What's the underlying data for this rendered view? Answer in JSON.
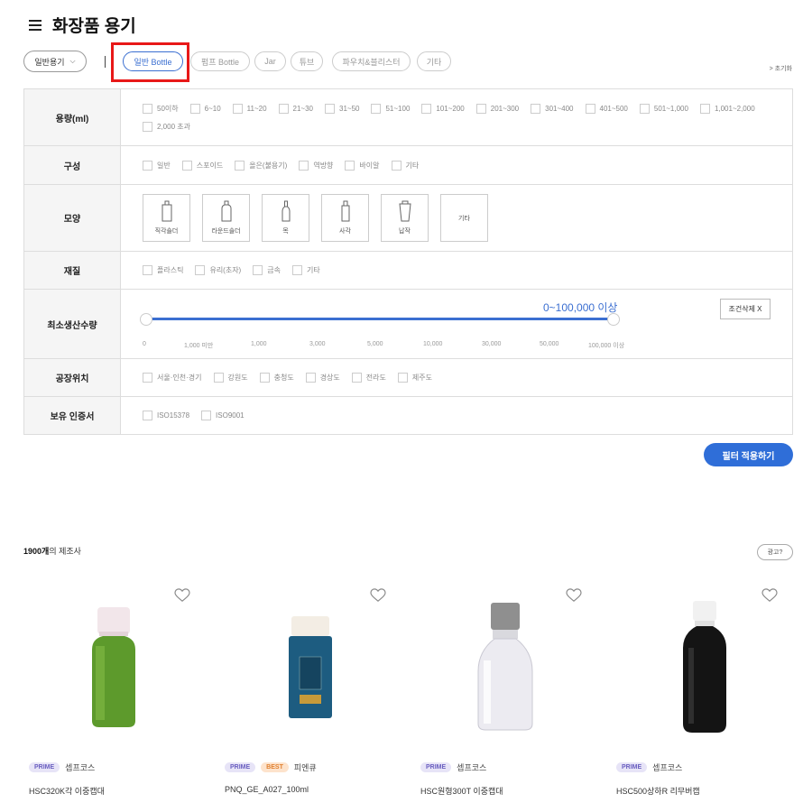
{
  "header": {
    "title": "화장품 용기",
    "menu_icon": "hamburger-menu-icon"
  },
  "categories": {
    "select_value": "일반용기",
    "pills": [
      "일반 Bottle",
      "펌프 Bottle",
      "Jar",
      "튜브",
      "파우치&블리스터",
      "기타"
    ],
    "active": "일반 Bottle",
    "reset_label": "> 초기화"
  },
  "filters": {
    "capacity": {
      "label": "용량(ml)",
      "options": [
        "50이하",
        "6~10",
        "11~20",
        "21~30",
        "31~50",
        "51~100",
        "101~200",
        "201~300",
        "301~400",
        "401~500",
        "501~1,000",
        "1,001~2,000",
        "2,000 초과"
      ]
    },
    "composition": {
      "label": "구성",
      "options": [
        "일반",
        "스포이드",
        "올은(불용기)",
        "역방향",
        "바이알",
        "기타"
      ]
    },
    "shape": {
      "label": "모양",
      "options": [
        "직각숄더",
        "라운드숄더",
        "목",
        "사각",
        "납작",
        "기타"
      ]
    },
    "material": {
      "label": "재질",
      "options": [
        "플라스틱",
        "유리(초자)",
        "금속",
        "기타"
      ]
    },
    "moq": {
      "label": "최소생산수량",
      "range_text": "0~100,000 이상",
      "range_min": 0,
      "range_max": 1,
      "ticks": [
        "0",
        "1,000 미만",
        "1,000",
        "3,000",
        "5,000",
        "10,000",
        "30,000",
        "50,000",
        "100,000 이상"
      ],
      "clear_label": "조건삭제 X"
    },
    "factory": {
      "label": "공장위치",
      "options": [
        "서울·인천·경기",
        "강원도",
        "충청도",
        "경상도",
        "전라도",
        "제주도"
      ]
    },
    "cert": {
      "label": "보유 인증서",
      "options": [
        "ISO15378",
        "ISO9001"
      ]
    }
  },
  "apply_label": "필터 적용하기",
  "results": {
    "count": "1900개",
    "suffix": "의 제조사",
    "ad_label": "광고?"
  },
  "products": [
    {
      "name": "HSC320K각 이중캡대",
      "maker": "셉프코스",
      "badges": [
        "PRIME"
      ]
    },
    {
      "name": "PNQ_GE_A027_100ml",
      "maker": "피엔큐",
      "badges": [
        "PRIME",
        "BEST"
      ]
    },
    {
      "name": "HSC원형300T 이중캡대",
      "maker": "셉프코스",
      "badges": [
        "PRIME"
      ]
    },
    {
      "name": "HSC500상하R 리무버캡",
      "maker": "셉프코스",
      "badges": [
        "PRIME"
      ]
    }
  ],
  "colors": {
    "accent": "#2f6ed8",
    "highlight": "#e81818",
    "prime_bg": "#e7e4f7",
    "best_bg": "#fde3cc"
  }
}
